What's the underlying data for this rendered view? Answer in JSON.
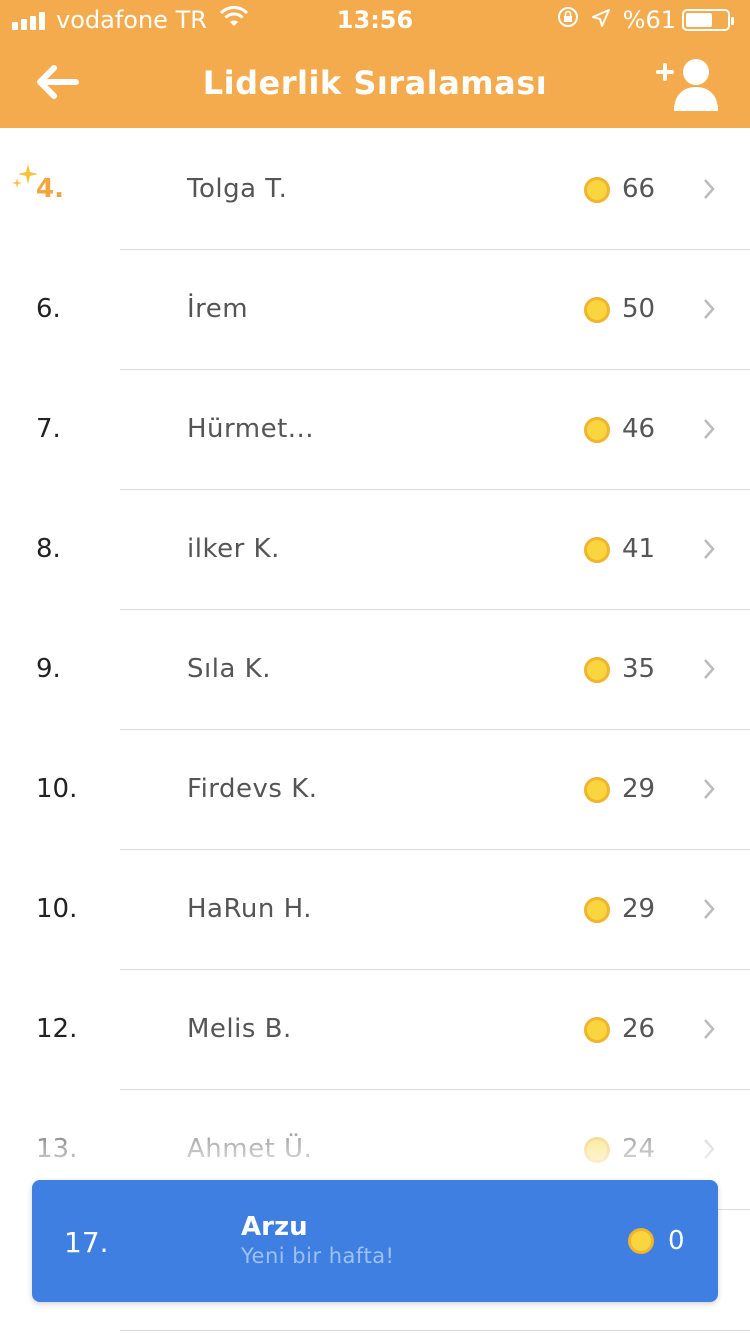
{
  "status_bar": {
    "carrier": "vodafone TR",
    "time": "13:56",
    "battery": "%61"
  },
  "header": {
    "title": "Liderlik Sıralaması",
    "back_icon": "arrow-left-icon",
    "add_friend_icon": "add-user-icon"
  },
  "leaderboard": [
    {
      "rank": "4.",
      "name": "Tolga T.",
      "points": "66",
      "highlight": true
    },
    {
      "rank": "6.",
      "name": "İrem",
      "points": "50"
    },
    {
      "rank": "7.",
      "name": "Hürmet...",
      "points": "46"
    },
    {
      "rank": "8.",
      "name": "ilker K.",
      "points": "41"
    },
    {
      "rank": "9.",
      "name": "Sıla K.",
      "points": "35"
    },
    {
      "rank": "10.",
      "name": "Firdevs K.",
      "points": "29"
    },
    {
      "rank": "10.",
      "name": "HaRun H.",
      "points": "29"
    },
    {
      "rank": "12.",
      "name": "Melis B.",
      "points": "26"
    },
    {
      "rank": "13.",
      "name": "Ahmet Ü.",
      "points": "24"
    }
  ],
  "current_user": {
    "rank": "17.",
    "name": "Arzu",
    "subtitle": "Yeni bir hafta!",
    "points": "0"
  },
  "colors": {
    "header": "#f4ab4e",
    "card": "#3e7fe1",
    "coin": "#f9d640",
    "highlight_rank": "#f0a53f"
  }
}
